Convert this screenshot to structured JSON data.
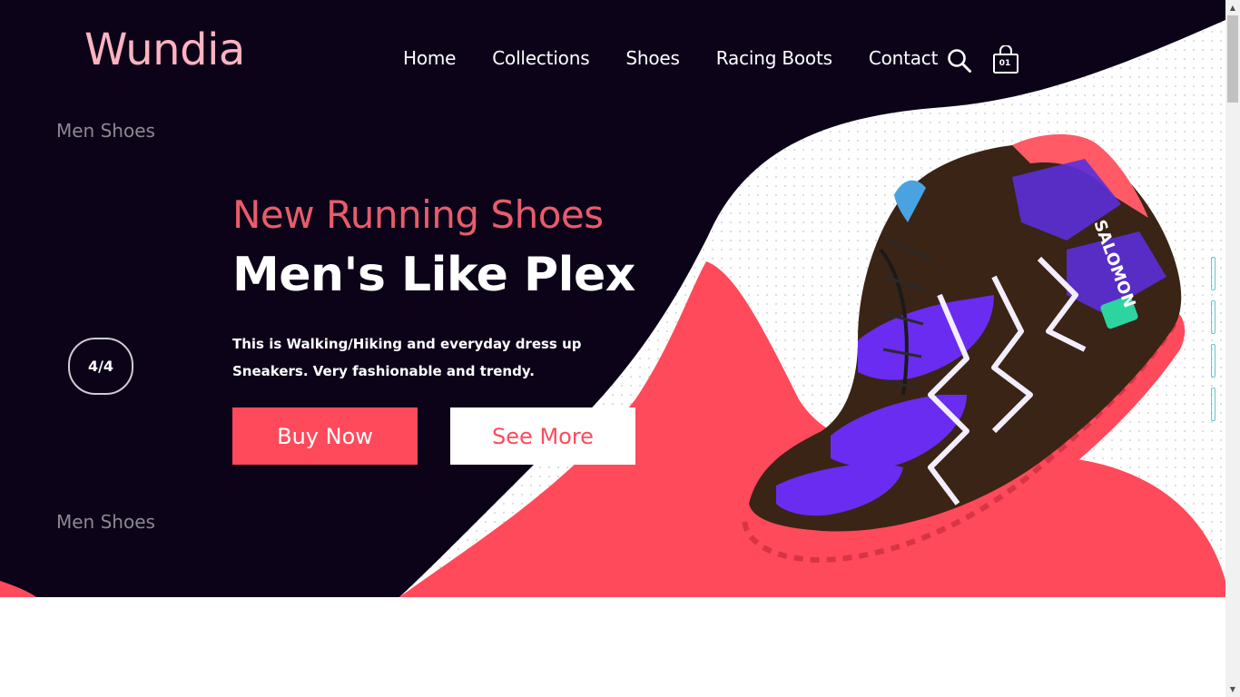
{
  "brand": {
    "logo": "Wundia"
  },
  "nav": {
    "items": [
      {
        "label": "Home"
      },
      {
        "label": "Collections"
      },
      {
        "label": "Shoes"
      },
      {
        "label": "Racing Boots"
      },
      {
        "label": "Contact"
      }
    ],
    "search_icon": "search-icon",
    "cart_icon": "shopping-bag-icon",
    "cart_count": "01"
  },
  "hero": {
    "side_label_top": "Men Shoes",
    "side_label_bottom": "Men Shoes",
    "slide_counter": "4/4",
    "subtitle": "New Running Shoes",
    "title": "Men's Like Plex",
    "description": "This is Walking/Hiking and everyday dress up Sneakers. Very fashionable and trendy.",
    "buy_label": "Buy Now",
    "more_label": "See More",
    "slider_dot_count": 4,
    "product_image": "running-shoe-image"
  },
  "colors": {
    "hero_background": "#0c0319",
    "accent": "#ff4a5c",
    "logo": "#ffb3c1",
    "subtitle": "#e85c6c",
    "slider_dot": "#5dc9cf"
  }
}
